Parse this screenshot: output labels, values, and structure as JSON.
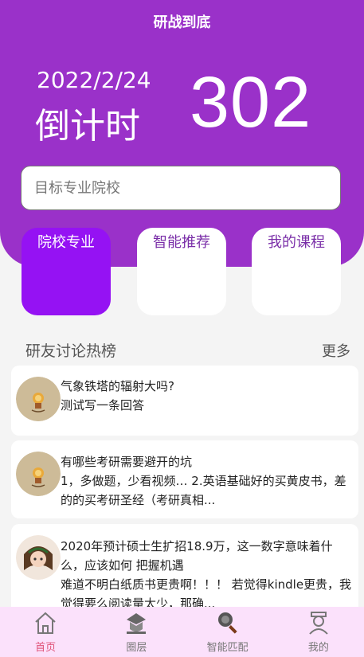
{
  "header": {
    "title": "研战到底"
  },
  "countdown": {
    "date": "2022/2/24",
    "label": "倒计时",
    "days": "302"
  },
  "search": {
    "placeholder": "目标专业院校"
  },
  "tiles": [
    {
      "label": "院校专业",
      "active": true
    },
    {
      "label": "智能推荐",
      "active": false
    },
    {
      "label": "我的课程",
      "active": false
    }
  ],
  "section": {
    "title": "研友讨论热榜",
    "more": "更多"
  },
  "posts": [
    {
      "question": "气象铁塔的辐射大吗?",
      "answer": "测试写一条回答"
    },
    {
      "question": "有哪些考研需要避开的坑",
      "answer": "1，多做题，少看视频… 2.英语基础好的买黄皮书，差的的买考研圣经（考研真相..."
    },
    {
      "question": "2020年预计硕士生扩招18.9万，这一数字意味着什么，应该如何 把握机遇",
      "answer": "难道不明白纸质书更贵啊！！！ 若觉得kindle更贵，我觉得要么阅读量太少，那确..."
    }
  ],
  "tabbar": [
    {
      "label": "首页",
      "icon": "home-icon",
      "active": true
    },
    {
      "label": "圈层",
      "icon": "hat-icon",
      "active": false
    },
    {
      "label": "智能匹配",
      "icon": "magnifier-icon",
      "active": false
    },
    {
      "label": "我的",
      "icon": "user-icon",
      "active": false
    }
  ],
  "colors": {
    "primary": "#9a31c9",
    "activeTile": "#9512f3",
    "tabbarBg": "#fbe1fb",
    "activeTab": "#e0547a"
  }
}
